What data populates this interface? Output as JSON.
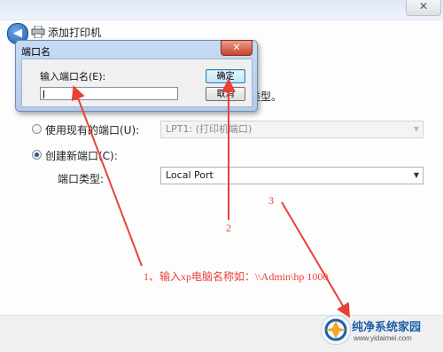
{
  "wizard": {
    "title": "添加打印机",
    "type_tail_text": "类型。",
    "close_glyph": "✕",
    "back_glyph": "◀"
  },
  "options": {
    "existing_port_label": "使用现有的端口(U):",
    "existing_port_value": "LPT1: (打印机端口)",
    "existing_port_selected": false,
    "new_port_label": "创建新端口(C):",
    "new_port_selected": true,
    "port_type_label": "端口类型:",
    "port_type_value": "Local Port"
  },
  "dialog": {
    "title": "端口名",
    "field_label": "输入端口名(E):",
    "input_value": "",
    "ok_label": "确定",
    "cancel_label": "取消",
    "close_glyph": "✕"
  },
  "annotations": {
    "step1": "1、输入xp电脑名称如：\\\\Admin\\hp 1000",
    "step2": "2",
    "step3": "3",
    "color": "#e8413a"
  },
  "watermark": {
    "brand": "纯净系统家园",
    "url": "www.yidaimei.com"
  }
}
